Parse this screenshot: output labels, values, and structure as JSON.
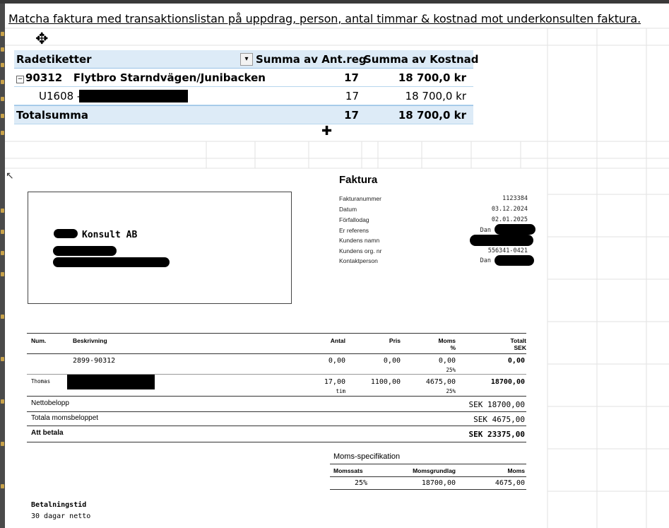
{
  "heading": "Matcha faktura med transaktionslistan på uppdrag, person, antal timmar & kostnad mot underkonsulten faktura.",
  "pivot": {
    "headers": {
      "row_labels": "Radetiketter",
      "hours": "Summa av Ant.reg",
      "cost": "Summa av Kostnad"
    },
    "collapse_symbol": "−",
    "filter_symbol": "▾",
    "group": {
      "label": "90312   Flytbro Starndvägen/Junibacken",
      "hours": "17",
      "cost": "18 700,0 kr"
    },
    "item": {
      "label": "U1608 -",
      "hours": "17",
      "cost": "18 700,0 kr"
    },
    "total": {
      "label": "Totalsumma",
      "hours": "17",
      "cost": "18 700,0 kr"
    }
  },
  "invoice": {
    "title": "Faktura",
    "meta": [
      {
        "label": "Fakturanummer",
        "value": "1123384"
      },
      {
        "label": "Datum",
        "value": "03.12.2024"
      },
      {
        "label": "Förfallodag",
        "value": "02.01.2025"
      },
      {
        "label": "Er referens",
        "value": "Dan"
      },
      {
        "label": "Kundens namn",
        "value": ""
      },
      {
        "label": "Kundens org. nr",
        "value": "556341-0421"
      },
      {
        "label": "Kontaktperson",
        "value": "Dan"
      }
    ],
    "company": "Konsult AB",
    "columns": {
      "num": "Num.",
      "desc": "Beskrivning",
      "qty": "Antal",
      "price": "Pris",
      "vat": "Moms",
      "vat_unit": "%",
      "total": "Totalt",
      "total_unit": "SEK"
    },
    "rows": [
      {
        "num": "",
        "desc": "2899-90312",
        "qty": "0,00",
        "qty_unit": "",
        "price": "0,00",
        "vat": "0,00",
        "vat_pct": "25%",
        "total": "0,00"
      },
      {
        "num": "Thomas",
        "desc": "",
        "qty": "17,00",
        "qty_unit": "tim",
        "price": "1100,00",
        "vat": "4675,00",
        "vat_pct": "25%",
        "total": "18700,00"
      }
    ],
    "summary": [
      {
        "label": "Nettobelopp",
        "value": "SEK 18700,00"
      },
      {
        "label": "Totala momsbeloppet",
        "value": "SEK 4675,00"
      },
      {
        "label": "Att betala",
        "value": "SEK 23375,00"
      }
    ],
    "vat_spec": {
      "title": "Moms-specifikation",
      "headers": {
        "rate": "Momssats",
        "base": "Momsgrundlag",
        "vat": "Moms"
      },
      "row": {
        "rate": "25%",
        "base": "18700,00",
        "vat": "4675,00"
      }
    },
    "payment": {
      "title": "Betalningstid",
      "value": "30 dagar netto"
    }
  }
}
